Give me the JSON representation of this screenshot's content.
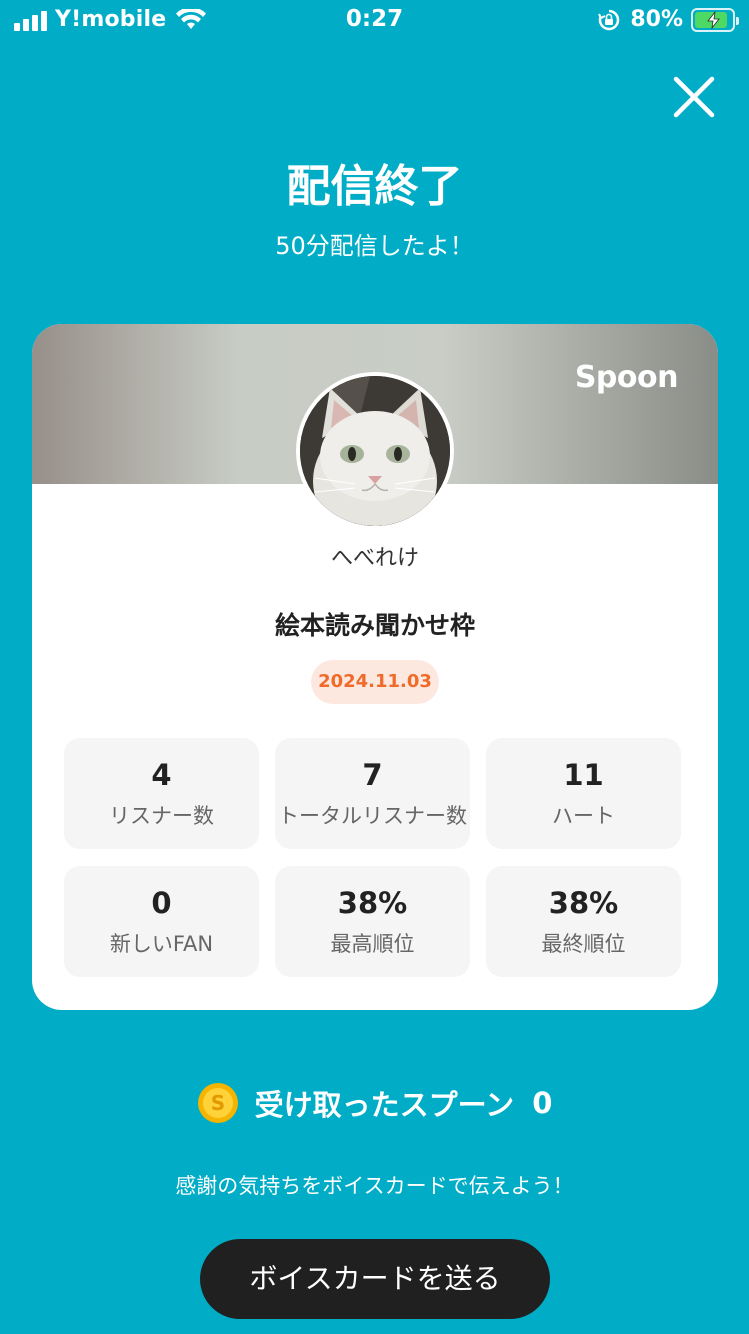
{
  "status_bar": {
    "carrier": "Y!mobile",
    "time": "0:27",
    "battery_percent": "80%",
    "icons": [
      "signal-icon",
      "wifi-icon",
      "rotation-lock-icon",
      "battery-charging-icon"
    ]
  },
  "header": {
    "close_icon": "close-icon",
    "title": "配信終了",
    "subtitle": "50分配信したよ！"
  },
  "card": {
    "brand": "Spoon",
    "avatar_icon": "avatar-cat",
    "username": "へべれけ",
    "stream_title": "絵本読み聞かせ枠",
    "date": "2024.11.03",
    "stats": [
      {
        "value": "4",
        "label": "リスナー数"
      },
      {
        "value": "7",
        "label": "トータルリスナー数"
      },
      {
        "value": "11",
        "label": "ハート"
      },
      {
        "value": "0",
        "label": "新しいFAN"
      },
      {
        "value": "38%",
        "label": "最高順位"
      },
      {
        "value": "38%",
        "label": "最終順位"
      }
    ]
  },
  "spoons": {
    "icon": "coin-icon",
    "label": "受け取ったスプーン",
    "count": "0"
  },
  "footer": {
    "thanks_text": "感謝の気持ちをボイスカードで伝えよう！",
    "send_button_label": "ボイスカードを送る"
  },
  "colors": {
    "background": "#01adc6",
    "date_badge_text": "#f06a2a",
    "button_bg": "#202020"
  }
}
